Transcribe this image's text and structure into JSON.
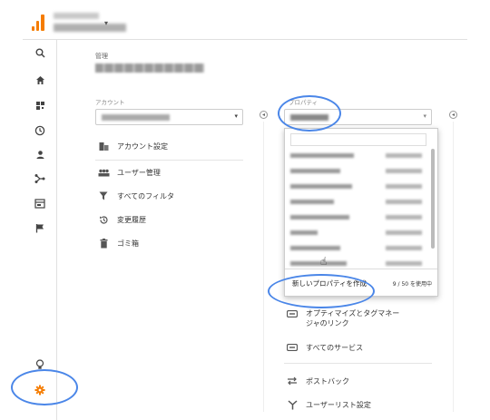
{
  "sidebar": {
    "icons": [
      "search-icon",
      "home-icon",
      "dashboard-icon",
      "clock-icon",
      "person-icon",
      "acquisition-icon",
      "behavior-icon",
      "flag-icon",
      "lightbulb-icon",
      "gear-icon"
    ]
  },
  "main": {
    "admin_label": "管理",
    "account": {
      "label": "アカウント",
      "items": [
        {
          "label": "アカウント設定",
          "icon": "building-icon"
        },
        {
          "label": "ユーザー管理",
          "icon": "users-icon"
        },
        {
          "label": "すべてのフィルタ",
          "icon": "filter-icon"
        },
        {
          "label": "変更履歴",
          "icon": "history-icon"
        },
        {
          "label": "ゴミ箱",
          "icon": "trash-icon"
        }
      ]
    },
    "property": {
      "label": "プロパティ",
      "dropdown": {
        "create_label": "新しいプロパティを作成",
        "usage": "9 / 50 を使用中"
      },
      "items": [
        {
          "label": "オプティマイズとタグマネージャのリンク",
          "icon": "link-icon"
        },
        {
          "label": "すべてのサービス",
          "icon": "services-icon"
        },
        {
          "label": "ポストバック",
          "icon": "postback-icon"
        },
        {
          "label": "ユーザーリスト設定",
          "icon": "userlist-icon"
        }
      ]
    }
  },
  "colors": {
    "accent": "#f57c00",
    "highlight": "#4a86e8"
  }
}
